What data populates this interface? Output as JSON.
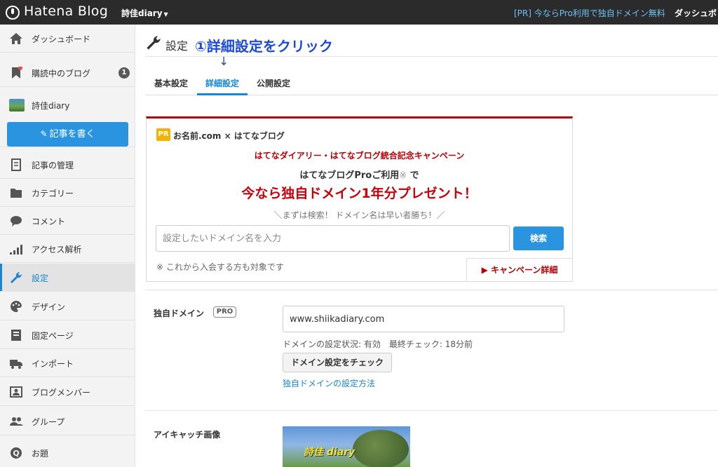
{
  "topbar": {
    "logo_text": "Hatena Blog",
    "blog_name": "詩佳diary",
    "pr_link": "[PR] 今ならPro利用で独自ドメイン無料",
    "dashboard_link": "ダッシュボ"
  },
  "sidebar": {
    "items": [
      {
        "label": "ダッシュボード",
        "icon": "home-icon"
      },
      {
        "label": "購読中のブログ",
        "icon": "bookmark-icon",
        "badge": "1"
      },
      {
        "label": "詩佳diary",
        "icon": "blog-thumbnail"
      },
      {
        "label": "記事の管理",
        "icon": "document-icon"
      },
      {
        "label": "カテゴリー",
        "icon": "folder-icon"
      },
      {
        "label": "コメント",
        "icon": "comment-icon"
      },
      {
        "label": "アクセス解析",
        "icon": "signal-icon"
      },
      {
        "label": "設定",
        "icon": "wrench-icon"
      },
      {
        "label": "デザイン",
        "icon": "palette-icon"
      },
      {
        "label": "固定ページ",
        "icon": "page-icon"
      },
      {
        "label": "インポート",
        "icon": "truck-icon"
      },
      {
        "label": "ブログメンバー",
        "icon": "member-icon"
      },
      {
        "label": "グループ",
        "icon": "group-icon"
      },
      {
        "label": "お題",
        "icon": "question-icon"
      }
    ],
    "write_button": "記事を書く"
  },
  "main": {
    "title": "設定",
    "annotation": "①詳細設定をクリック",
    "annotation_arrow": "↓",
    "tabs": [
      {
        "label": "基本設定"
      },
      {
        "label": "詳細設定"
      },
      {
        "label": "公開設定"
      }
    ],
    "pr_box": {
      "tag": "PR",
      "brand": "お名前.com × はてなブログ",
      "campaign": "はてなダイアリー・はてなブログ統合記念キャンペーン",
      "line2": "はてなブログProご利用",
      "line2_mark": "※",
      "line2_suffix": " で",
      "headline": "今なら独自ドメイン1年分プレゼント！",
      "sub": "＼まずは検索！ ドメイン名は早い者勝ち！／",
      "input_placeholder": "設定したいドメイン名を入力",
      "search_button": "検索",
      "note": "※ これから入会する方も対象です",
      "detail_link": "▶ キャンペーン詳細"
    },
    "domain": {
      "label": "独自ドメイン",
      "pro_badge": "PRO",
      "value": "www.shiikadiary.com",
      "status": "ドメインの設定状況: 有効　最終チェック: 18分前",
      "check_button": "ドメイン設定をチェック",
      "howto_link": "独自ドメインの設定方法"
    },
    "eyecatch": {
      "label": "アイキャッチ画像",
      "image_text": "詩佳 diary"
    }
  },
  "colors": {
    "accent": "#2b94e0",
    "active": "#1a86d0",
    "pr_red": "#b60005",
    "annotation_blue": "#1e4ad8"
  }
}
